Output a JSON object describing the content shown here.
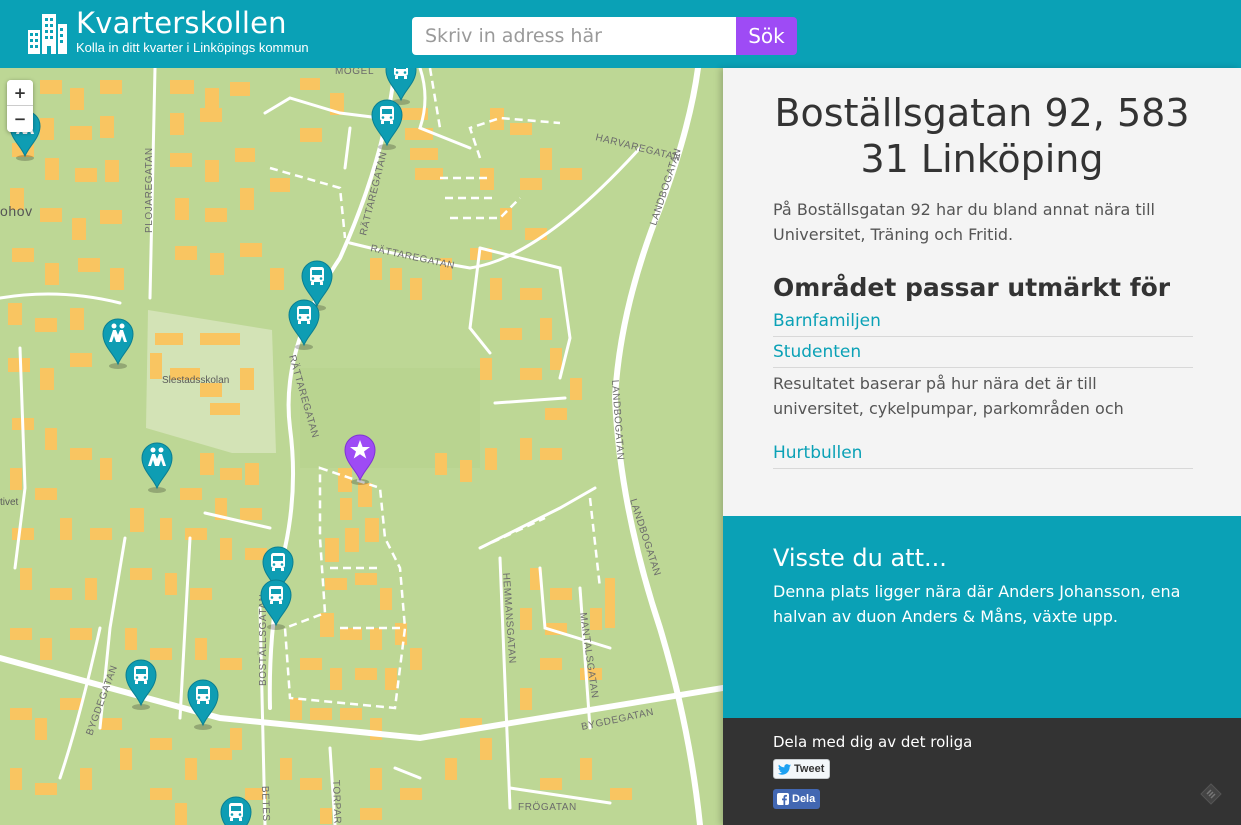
{
  "header": {
    "title": "Kvarterskollen",
    "subtitle": "Kolla in ditt kvarter i Linköpings kommun",
    "search_placeholder": "Skriv in adress här",
    "search_button": "Sök"
  },
  "map": {
    "zoom_in": "+",
    "zoom_out": "−",
    "labels": {
      "mogel": "MOGEL",
      "plojaregatan": "PLOJAREGATAN",
      "hov": "ohov",
      "rattaregatan_1": "RÄTTAREGATAN",
      "rattaregatan_2": "RÄTTAREGATAN",
      "rattaregatan_3": "RÄTTAREGATAN",
      "harvaregatan": "HARVAREGATAN",
      "landbogatan_1": "LANDBOGATAN",
      "landbogatan_2": "LANDBOGATAN",
      "landbogatan_3": "LANDBOGATAN",
      "slestadsskolan": "Slestadsskolan",
      "tivet": "tivet",
      "hemmansgatan": "HEMMANSGATAN",
      "mantalsgatan": "MANTALSGATAN",
      "bostallsgatan": "BOSTÄLLSGATAN",
      "bygdegatan_1": "BYGDEGATAN",
      "bygdegatan_2": "BYGDEGATAN",
      "torparegatan": "TORPAREG",
      "betesgatan": "BETES",
      "frogatan": "FRÖGATAN"
    }
  },
  "panel": {
    "address": "Boställsgatan 92, 583 31 Linköping",
    "intro": "På Boställsgatan 92 har du bland annat nära till Universitet, Träning och Fritid.",
    "suits_heading": "Området passar utmärkt för",
    "suits": [
      "Barnfamiljen",
      "Studenten",
      "Hurtbullen"
    ],
    "result_text": "Resultatet baserar på hur nära det är till universitet, cykelpumpar, parkområden och",
    "fact_title": "Visste du att...",
    "fact_text": "Denna plats ligger nära där Anders Johansson, ena halvan av duon Anders & Måns, växte upp.",
    "share_title": "Dela med dig av det roliga",
    "tweet_label": "Tweet",
    "fb_label": "Dela"
  },
  "colors": {
    "header": "#0aa1b6",
    "search_button": "#9e4bf5",
    "map_green": "#bdd795",
    "building": "#f9c561",
    "marker_teal": "#0e9db3",
    "marker_purple": "#9e4bf5",
    "share_bg": "#333333"
  },
  "icons": {
    "logo": "city-buildings-icon",
    "bus_marker": "bus-icon",
    "school_marker": "children-crossing-icon",
    "location_marker": "star-icon",
    "twitter": "twitter-bird-icon",
    "facebook": "facebook-f-icon",
    "corner": "leaflet-icon"
  }
}
